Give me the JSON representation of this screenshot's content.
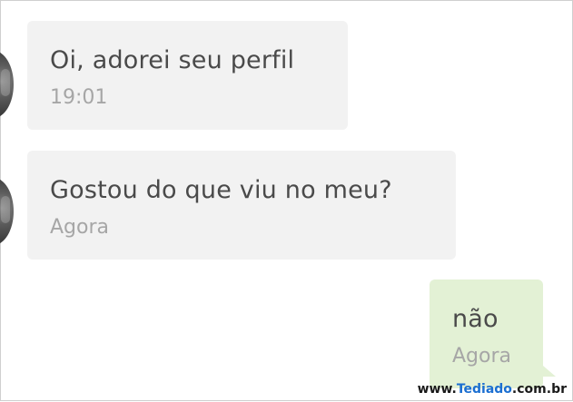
{
  "conversation": {
    "messages": [
      {
        "direction": "incoming",
        "text": "Oi, adorei seu perfil",
        "time": "19:01"
      },
      {
        "direction": "incoming",
        "text": "Gostou do que viu no meu?",
        "time": "Agora"
      },
      {
        "direction": "outgoing",
        "text": "não",
        "time": "Agora"
      }
    ]
  },
  "watermark": {
    "prefix": "www.",
    "brand": "Tediado",
    "suffix": ".com.br"
  },
  "colors": {
    "incoming_bubble": "#f2f2f2",
    "outgoing_bubble": "#e3f1d5",
    "message_text": "#4a4a4a",
    "timestamp_text": "#a6a6a6",
    "watermark_brand": "#1b6fd1"
  }
}
